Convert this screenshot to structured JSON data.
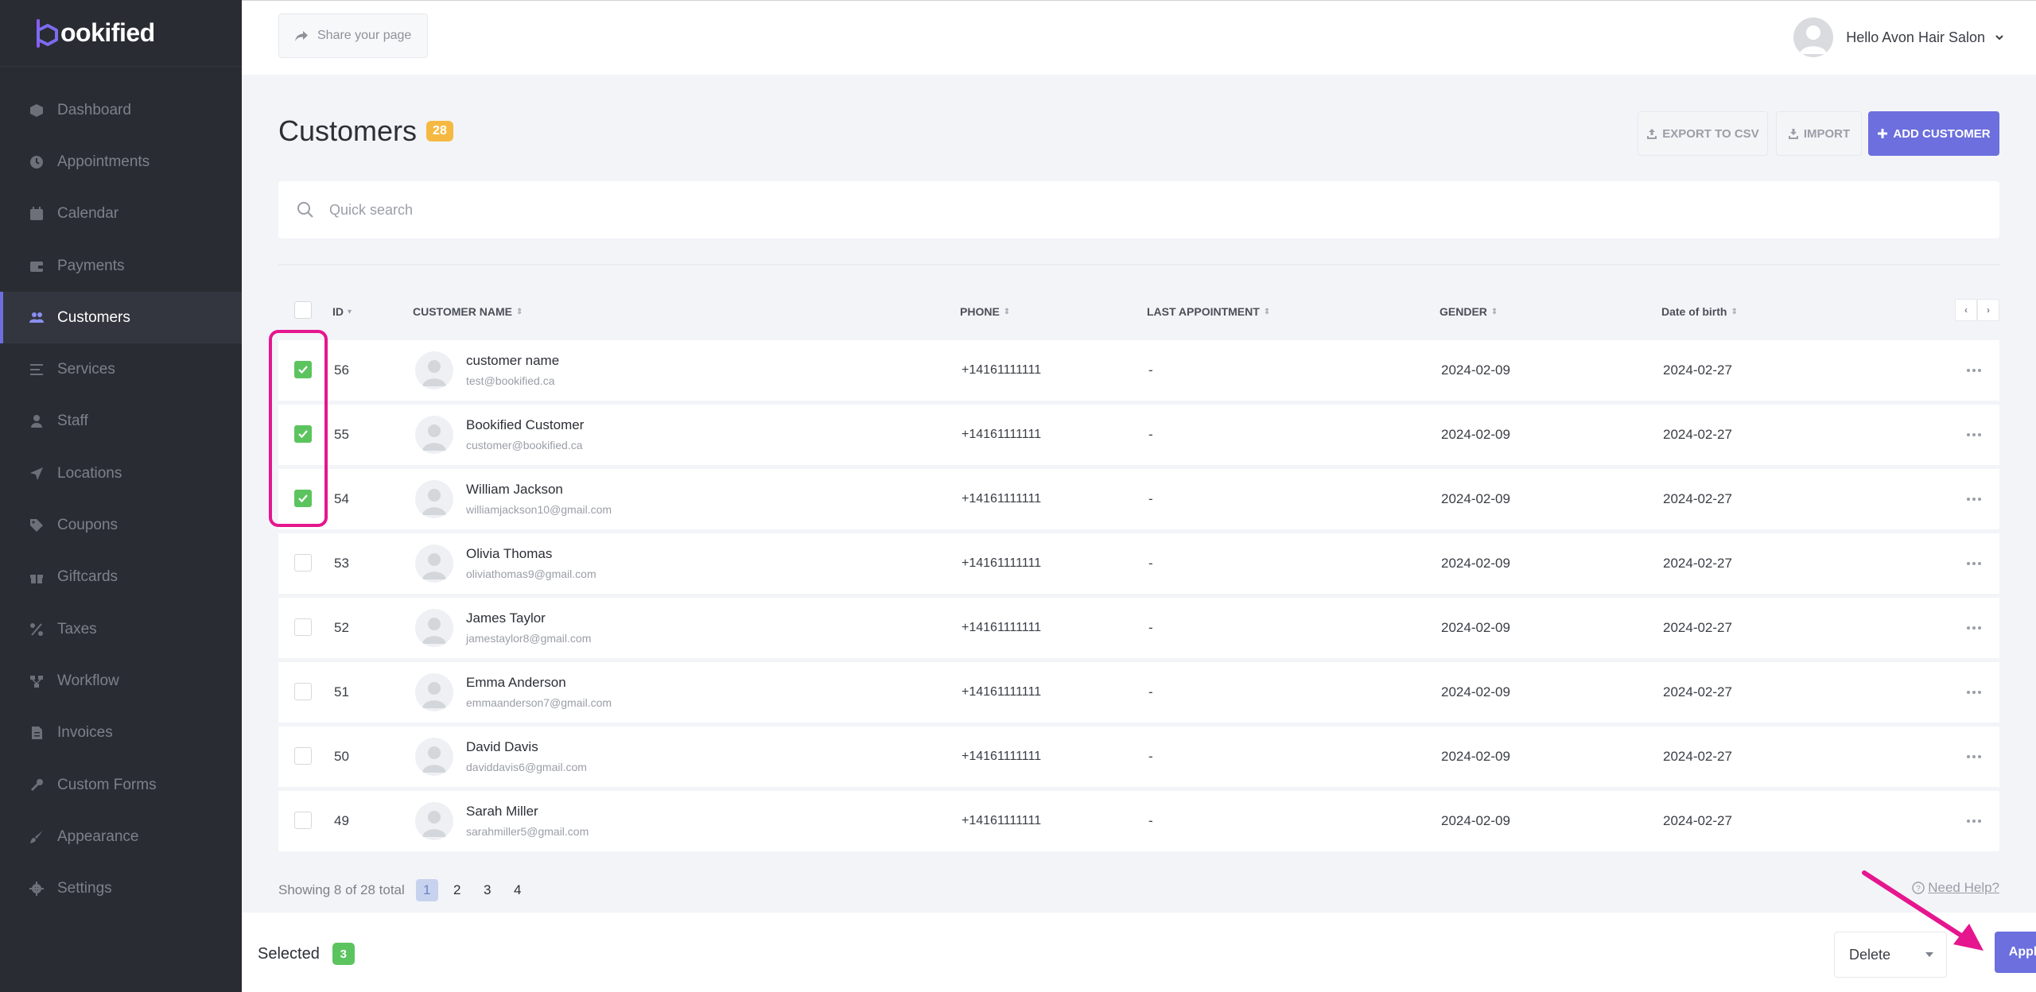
{
  "app": {
    "logo_text": "ookified",
    "accent_color": "#6c6fdd",
    "sidebar_bg": "#292c33"
  },
  "sidebar": {
    "items": [
      {
        "label": "Dashboard",
        "icon": "dashboard-icon",
        "active": false
      },
      {
        "label": "Appointments",
        "icon": "clock-icon",
        "active": false
      },
      {
        "label": "Calendar",
        "icon": "calendar-icon",
        "active": false
      },
      {
        "label": "Payments",
        "icon": "wallet-icon",
        "active": false
      },
      {
        "label": "Customers",
        "icon": "users-icon",
        "active": true
      },
      {
        "label": "Services",
        "icon": "list-icon",
        "active": false
      },
      {
        "label": "Staff",
        "icon": "user-icon",
        "active": false
      },
      {
        "label": "Locations",
        "icon": "location-arrow-icon",
        "active": false
      },
      {
        "label": "Coupons",
        "icon": "tag-icon",
        "active": false
      },
      {
        "label": "Giftcards",
        "icon": "gift-icon",
        "active": false
      },
      {
        "label": "Taxes",
        "icon": "percent-icon",
        "active": false
      },
      {
        "label": "Workflow",
        "icon": "workflow-icon",
        "active": false
      },
      {
        "label": "Invoices",
        "icon": "invoice-icon",
        "active": false
      },
      {
        "label": "Custom Forms",
        "icon": "tools-icon",
        "active": false
      },
      {
        "label": "Appearance",
        "icon": "brush-icon",
        "active": false
      },
      {
        "label": "Settings",
        "icon": "gear-icon",
        "active": false
      }
    ]
  },
  "topbar": {
    "share_label": "Share your page",
    "user_greeting": "Hello Avon Hair Salon"
  },
  "page": {
    "title": "Customers",
    "count": "28",
    "export_label": "EXPORT TO CSV",
    "import_label": "IMPORT",
    "add_label": "ADD CUSTOMER"
  },
  "search": {
    "placeholder": "Quick search",
    "value": ""
  },
  "table": {
    "columns": {
      "id": "ID",
      "name": "CUSTOMER NAME",
      "phone": "PHONE",
      "last": "LAST APPOINTMENT",
      "gender": "GENDER",
      "dob": "Date of birth"
    },
    "rows": [
      {
        "id": "56",
        "name": "customer name",
        "email": "test@bookified.ca",
        "phone": "+14161111111",
        "last": "-",
        "gender": "2024-02-09",
        "dob": "2024-02-27",
        "checked": true
      },
      {
        "id": "55",
        "name": "Bookified Customer",
        "email": "customer@bookified.ca",
        "phone": "+14161111111",
        "last": "-",
        "gender": "2024-02-09",
        "dob": "2024-02-27",
        "checked": true
      },
      {
        "id": "54",
        "name": "William Jackson",
        "email": "williamjackson10@gmail.com",
        "phone": "+14161111111",
        "last": "-",
        "gender": "2024-02-09",
        "dob": "2024-02-27",
        "checked": true
      },
      {
        "id": "53",
        "name": "Olivia Thomas",
        "email": "oliviathomas9@gmail.com",
        "phone": "+14161111111",
        "last": "-",
        "gender": "2024-02-09",
        "dob": "2024-02-27",
        "checked": false
      },
      {
        "id": "52",
        "name": "James Taylor",
        "email": "jamestaylor8@gmail.com",
        "phone": "+14161111111",
        "last": "-",
        "gender": "2024-02-09",
        "dob": "2024-02-27",
        "checked": false
      },
      {
        "id": "51",
        "name": "Emma Anderson",
        "email": "emmaanderson7@gmail.com",
        "phone": "+14161111111",
        "last": "-",
        "gender": "2024-02-09",
        "dob": "2024-02-27",
        "checked": false
      },
      {
        "id": "50",
        "name": "David Davis",
        "email": "daviddavis6@gmail.com",
        "phone": "+14161111111",
        "last": "-",
        "gender": "2024-02-09",
        "dob": "2024-02-27",
        "checked": false
      },
      {
        "id": "49",
        "name": "Sarah Miller",
        "email": "sarahmiller5@gmail.com",
        "phone": "+14161111111",
        "last": "-",
        "gender": "2024-02-09",
        "dob": "2024-02-27",
        "checked": false
      }
    ]
  },
  "pagination": {
    "showing": "Showing 8 of 28 total",
    "pages": [
      "1",
      "2",
      "3",
      "4"
    ],
    "current": "1",
    "help_label": "Need Help?"
  },
  "bulk": {
    "selected_label": "Selected",
    "selected_count": "3",
    "action_value": "Delete",
    "apply_label": "Apply"
  },
  "annotations": {
    "highlight_color": "#e5168e"
  }
}
